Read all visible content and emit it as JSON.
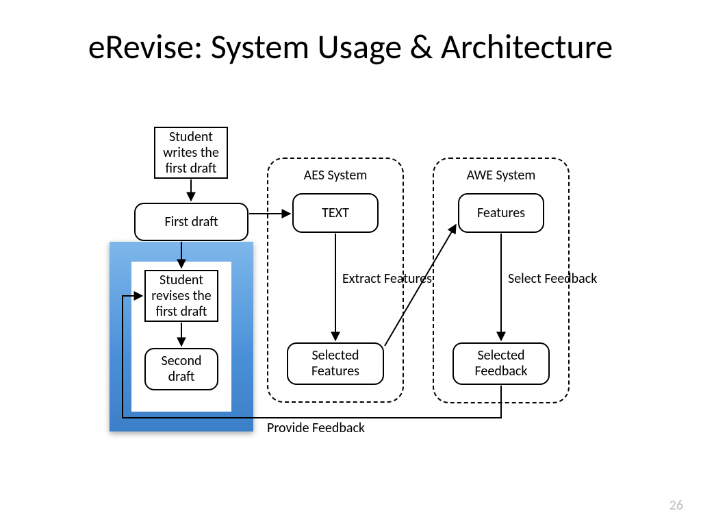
{
  "title": "eRevise: System Usage & Architecture",
  "pageNumber": "26",
  "groups": {
    "aes": "AES System",
    "awe": "AWE System"
  },
  "boxes": {
    "writeFirst": "Student\nwrites the\nfirst draft",
    "firstDraft": "First draft",
    "reviseFirst": "Student\nrevises the\nfirst draft",
    "secondDraft": "Second\ndraft",
    "text": "TEXT",
    "selectedFeatures": "Selected\nFeatures",
    "features": "Features",
    "selectedFeedback": "Selected\nFeedback"
  },
  "edgeLabels": {
    "extractFeatures": "Extract\nFeatures",
    "selectFeedback": "Select\nFeedback",
    "provideFeedback": "Provide Feedback"
  }
}
